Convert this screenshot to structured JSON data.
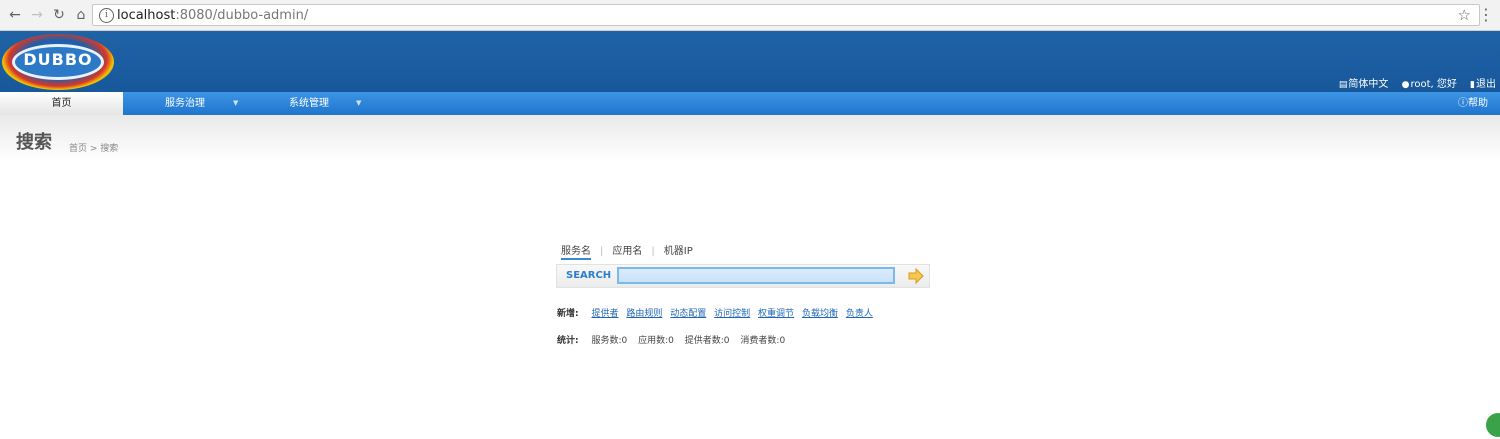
{
  "browser": {
    "url_host": "localhost",
    "url_rest": ":8080/dubbo-admin/"
  },
  "header": {
    "logo_text": "DUBBO",
    "language": "简体中文",
    "user": "root, 您好",
    "logout": "退出"
  },
  "menu": {
    "home": "首页",
    "service_governance": "服务治理",
    "system_management": "系统管理",
    "help": "帮助"
  },
  "page": {
    "title": "搜索",
    "breadcrumb": "首页 > 搜索"
  },
  "search": {
    "tabs": [
      "服务名",
      "应用名",
      "机器IP"
    ],
    "label": "SEARCH",
    "value": ""
  },
  "new_items": {
    "label": "新增:",
    "links": [
      "提供者",
      "路由规则",
      "动态配置",
      "访问控制",
      "权重调节",
      "负载均衡",
      "负责人"
    ]
  },
  "stats": {
    "label": "统计:",
    "services": "服务数:0",
    "apps": "应用数:0",
    "providers": "提供者数:0",
    "consumers": "消费者数:0"
  }
}
